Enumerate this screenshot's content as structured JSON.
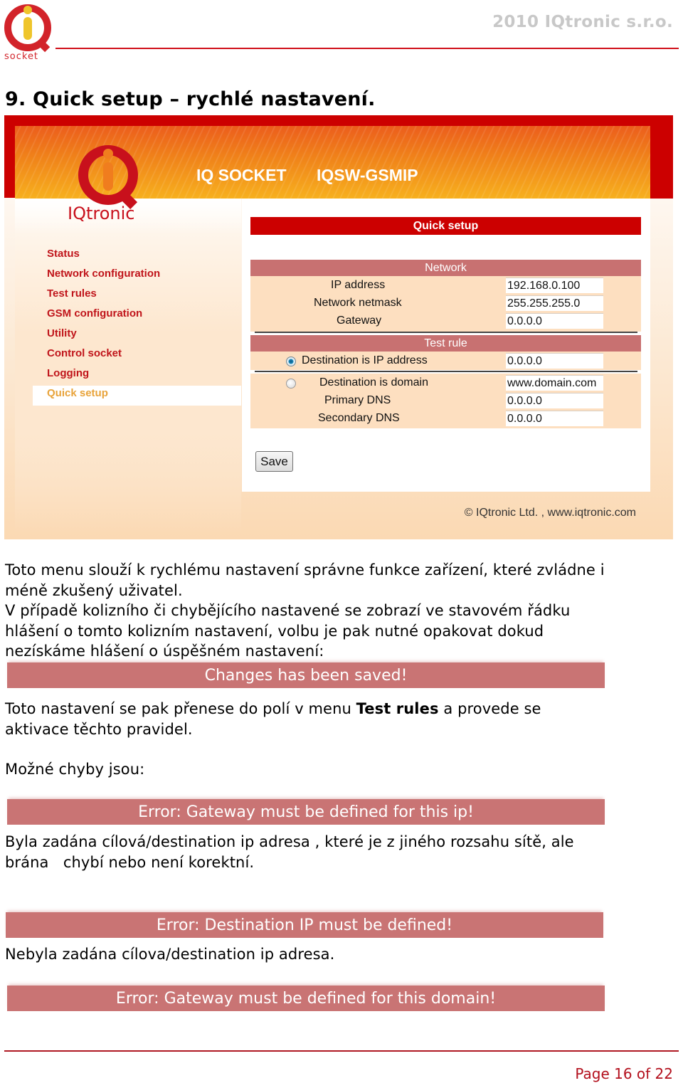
{
  "header": {
    "company": "2010 IQtronic  s.r.o.",
    "logo_text": "socket"
  },
  "title": "9. Quick setup – rychlé nastavení.",
  "screenshot": {
    "banner": {
      "product": "IQ SOCKET",
      "model": "IQSW-GSMIP",
      "brand_logo": "IQtronic"
    },
    "sidebar": {
      "items": [
        {
          "label": "Status",
          "active": false
        },
        {
          "label": "Network configuration",
          "active": false
        },
        {
          "label": "Test rules",
          "active": false
        },
        {
          "label": "GSM configuration",
          "active": false
        },
        {
          "label": "Utility",
          "active": false
        },
        {
          "label": "Control socket",
          "active": false
        },
        {
          "label": "Logging",
          "active": false
        },
        {
          "label": "Quick setup",
          "active": true
        }
      ]
    },
    "panel_title": "Quick setup",
    "network": {
      "heading": "Network",
      "ip_label": "IP address",
      "ip_value": "192.168.0.100",
      "netmask_label": "Network netmask",
      "netmask_value": "255.255.255.0",
      "gateway_label": "Gateway",
      "gateway_value": "0.0.0.0"
    },
    "test_rule": {
      "heading": "Test rule",
      "dest_ip_label": "Destination is IP address",
      "dest_ip_value": "0.0.0.0",
      "dest_ip_selected": true,
      "dest_domain_label": "Destination is domain",
      "dest_domain_value": "www.domain.com",
      "dest_domain_selected": false,
      "primary_dns_label": "Primary DNS",
      "primary_dns_value": "0.0.0.0",
      "secondary_dns_label": "Secondary DNS",
      "secondary_dns_value": "0.0.0.0"
    },
    "save_label": "Save",
    "copyright": "© IQtronic Ltd. , www.iqtronic.com"
  },
  "body": {
    "p1_line1": "Toto menu slouží k rychlému nastavení správne funkce zařízení, které zvládne i",
    "p1_line2": "méně zkušený uživatel.",
    "p2_line1": "V případě kolizního či chybějícího nastavené se zobrazí ve stavovém řádku",
    "p2_line2": "hlášení o tomto kolizním nastavení, volbu je pak nutné opakovat dokud",
    "p2_line3": "nezískáme hlášení o úspěšném nastavení:",
    "msg_saved": "Changes has been saved!",
    "p3_pre": "Toto nastavení se pak přenese do polí v menu ",
    "p3_bold": "Test rules",
    "p3_post": "  a provede se",
    "p3_line2": "aktivace těchto pravidel.",
    "errors_heading": "Možné chyby jsou:",
    "err1": "Error: Gateway must be defined for this ip!",
    "err1_desc_line1": "Byla zadána cílová/destination ip adresa , které je z jiného rozsahu sítě, ale",
    "err1_desc_line2": "brána   chybí nebo není korektní.",
    "err2": "Error: Destination IP must be defined!",
    "err2_desc": "Nebyla zadána cílova/destination ip adresa.",
    "err3": "Error: Gateway must be defined for this domain!"
  },
  "footer": {
    "page": "Page 16 of 22"
  },
  "colors": {
    "brand_red": "#cc0000",
    "section_rose": "#c87171",
    "form_peach": "#fddfc0",
    "menu_red": "#c0141a",
    "menu_active": "#e8a33a",
    "message_bar": "#c97474"
  }
}
